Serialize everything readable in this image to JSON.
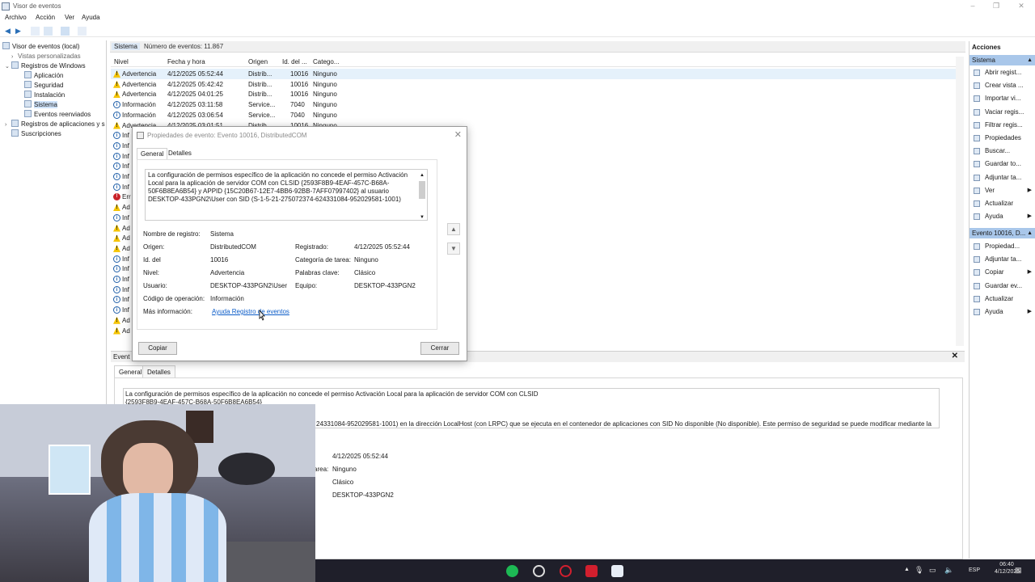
{
  "window": {
    "title": "Visor de eventos"
  },
  "menu": [
    "Archivo",
    "Acción",
    "Ver",
    "Ayuda"
  ],
  "tree": {
    "root": "Visor de eventos (local)",
    "custom_views": "Vistas personalizadas",
    "windows_logs": "Registros de Windows",
    "items": [
      "Aplicación",
      "Seguridad",
      "Instalación",
      "Sistema",
      "Eventos reenviados"
    ],
    "app_logs": "Registros de aplicaciones y s",
    "subscriptions": "Suscripciones"
  },
  "center": {
    "title": "Sistema",
    "count": "Número de eventos: 11.867",
    "columns": [
      "Nivel",
      "Fecha y hora",
      "Origen",
      "Id. del ...",
      "Catego..."
    ],
    "rows": [
      {
        "level": "warning",
        "level_label": "Advertencia",
        "date": "4/12/2025 05:52:44",
        "source": "Distrib...",
        "id": "10016",
        "category": "Ninguno"
      },
      {
        "level": "warning",
        "level_label": "Advertencia",
        "date": "4/12/2025 05:42:42",
        "source": "Distrib...",
        "id": "10016",
        "category": "Ninguno"
      },
      {
        "level": "warning",
        "level_label": "Advertencia",
        "date": "4/12/2025 04:01:25",
        "source": "Distrib...",
        "id": "10016",
        "category": "Ninguno"
      },
      {
        "level": "info",
        "level_label": "Información",
        "date": "4/12/2025 03:11:58",
        "source": "Service...",
        "id": "7040",
        "category": "Ninguno"
      },
      {
        "level": "info",
        "level_label": "Información",
        "date": "4/12/2025 03:06:54",
        "source": "Service...",
        "id": "7040",
        "category": "Ninguno"
      },
      {
        "level": "warning",
        "level_label": "Advertencia",
        "date": "4/12/2025 03:01:51",
        "source": "Distrib...",
        "id": "10016",
        "category": "Ninguno"
      },
      {
        "level": "info",
        "level_label": "Inf",
        "date": "",
        "source": "",
        "id": "",
        "category": ""
      },
      {
        "level": "info",
        "level_label": "Inf",
        "date": "",
        "source": "",
        "id": "",
        "category": ""
      },
      {
        "level": "info",
        "level_label": "Inf",
        "date": "",
        "source": "",
        "id": "",
        "category": ""
      },
      {
        "level": "info",
        "level_label": "Inf",
        "date": "",
        "source": "",
        "id": "",
        "category": ""
      },
      {
        "level": "info",
        "level_label": "Inf",
        "date": "",
        "source": "",
        "id": "",
        "category": ""
      },
      {
        "level": "info",
        "level_label": "Inf",
        "date": "",
        "source": "",
        "id": "",
        "category": ""
      },
      {
        "level": "error",
        "level_label": "Err",
        "date": "",
        "source": "",
        "id": "",
        "category": ""
      },
      {
        "level": "warning",
        "level_label": "Ad",
        "date": "",
        "source": "",
        "id": "",
        "category": ""
      },
      {
        "level": "info",
        "level_label": "Inf",
        "date": "",
        "source": "",
        "id": "",
        "category": ""
      },
      {
        "level": "warning",
        "level_label": "Ad",
        "date": "",
        "source": "",
        "id": "",
        "category": ""
      },
      {
        "level": "warning",
        "level_label": "Ad",
        "date": "",
        "source": "",
        "id": "",
        "category": ""
      },
      {
        "level": "warning",
        "level_label": "Ad",
        "date": "",
        "source": "",
        "id": "",
        "category": ""
      },
      {
        "level": "info",
        "level_label": "Inf",
        "date": "",
        "source": "",
        "id": "",
        "category": ""
      },
      {
        "level": "info",
        "level_label": "Inf",
        "date": "",
        "source": "",
        "id": "",
        "category": ""
      },
      {
        "level": "info",
        "level_label": "Inf",
        "date": "",
        "source": "",
        "id": "",
        "category": ""
      },
      {
        "level": "info",
        "level_label": "Inf",
        "date": "",
        "source": "",
        "id": "",
        "category": ""
      },
      {
        "level": "info",
        "level_label": "Inf",
        "date": "",
        "source": "",
        "id": "",
        "category": ""
      },
      {
        "level": "info",
        "level_label": "Inf",
        "date": "",
        "source": "",
        "id": "",
        "category": ""
      },
      {
        "level": "warning",
        "level_label": "Ad",
        "date": "",
        "source": "",
        "id": "",
        "category": ""
      },
      {
        "level": "warning",
        "level_label": "Ad",
        "date": "",
        "source": "",
        "id": "",
        "category": ""
      }
    ]
  },
  "actions": {
    "header": "Acciones",
    "section1": "Sistema",
    "items1": [
      {
        "label": "Abrir regist...",
        "sub": false
      },
      {
        "label": "Crear vista ...",
        "sub": false
      },
      {
        "label": "Importar vi...",
        "sub": false
      },
      {
        "label": "Vaciar regis...",
        "sub": false
      },
      {
        "label": "Filtrar regis...",
        "sub": false
      },
      {
        "label": "Propiedades",
        "sub": false
      },
      {
        "label": "Buscar...",
        "sub": false
      },
      {
        "label": "Guardar to...",
        "sub": false
      },
      {
        "label": "Adjuntar ta...",
        "sub": false
      },
      {
        "label": "Ver",
        "sub": true
      },
      {
        "label": "Actualizar",
        "sub": false
      },
      {
        "label": "Ayuda",
        "sub": true
      }
    ],
    "section2": "Evento 10016, D...",
    "items2": [
      {
        "label": "Propiedad...",
        "sub": false
      },
      {
        "label": "Adjuntar ta...",
        "sub": false
      },
      {
        "label": "Copiar",
        "sub": true
      },
      {
        "label": "Guardar ev...",
        "sub": false
      },
      {
        "label": "Actualizar",
        "sub": false
      },
      {
        "label": "Ayuda",
        "sub": true
      }
    ]
  },
  "dialog": {
    "title": "Propiedades de evento: Evento 10016, DistributedCOM",
    "tabs": [
      "General",
      "Detalles"
    ],
    "description": "La configuración de permisos específico de la aplicación no concede el permiso Activación Local para la aplicación de servidor COM con CLSID {2593F8B9-4EAF-457C-B68A-50F6B8EA6B54} y APPID {15C20B67-12E7-4BB6-92BB-7AFF07997402} al usuario DESKTOP-433PGN2\\User con SID (S-1-5-21-275072374-624331084-952029581-1001)",
    "labels": {
      "log_name": "Nombre de registro:",
      "source": "Origen:",
      "event_id": "Id. del",
      "level": "Nivel:",
      "user": "Usuario:",
      "opcode": "Código de operación:",
      "more_info": "Más información:",
      "logged": "Registrado:",
      "task_category": "Categoría de tarea:",
      "keywords": "Palabras clave:",
      "computer": "Equipo:"
    },
    "values": {
      "log_name": "Sistema",
      "source": "DistributedCOM",
      "event_id": "10016",
      "level": "Advertencia",
      "user": "DESKTOP-433PGN2\\User",
      "opcode": "Información",
      "more_info_link": "Ayuda Registro de eventos",
      "logged": "4/12/2025 05:52:44",
      "task_category": "Ninguno",
      "keywords": "Clásico",
      "computer": "DESKTOP-433PGN2"
    },
    "copy_button": "Copiar",
    "close_button": "Cerrar"
  },
  "details_pane": {
    "title": "Event",
    "tabs": [
      "General",
      "Detalles"
    ],
    "text_line1": "La configuración de permisos específico de la aplicación no concede el permiso Activación Local para la aplicación de servidor COM con CLSID",
    "text_line2": "{2593F8B9-4EAF-457C-B68A-50F6B8EA6B54}",
    "text_line3": "24331084-952029581-1001) en la dirección LocalHost (con LRPC) que se ejecuta en el contenedor de aplicaciones con SID No disponible (No disponible). Este permiso de seguridad se puede modificar mediante la",
    "logged": "4/12/2025 05:52:44",
    "task_label": "area:",
    "task_category": "Ninguno",
    "keywords": "Clásico",
    "computer": "DESKTOP-433PGN2"
  },
  "taskbar": {
    "lang": "ESP",
    "time": "06:40",
    "date": "4/12/2025"
  }
}
